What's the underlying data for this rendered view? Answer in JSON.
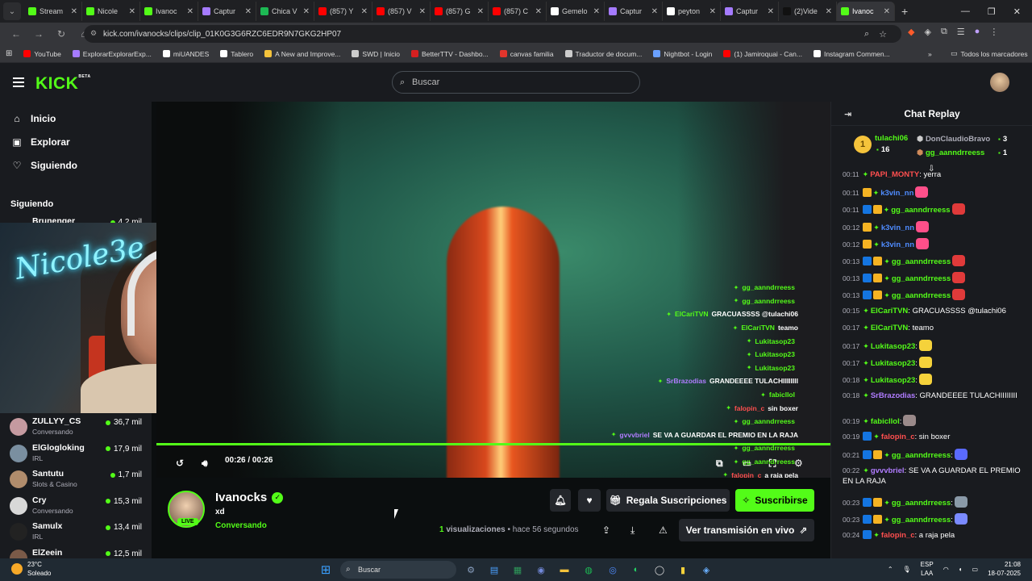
{
  "browser": {
    "tabs": [
      {
        "title": "Stream",
        "color": "#53fc18"
      },
      {
        "title": "Nicole",
        "color": "#53fc18"
      },
      {
        "title": "Ivanoc",
        "color": "#53fc18"
      },
      {
        "title": "Captur",
        "color": "#a57bff"
      },
      {
        "title": "Chica V",
        "color": "#1db954"
      },
      {
        "title": "(857) Y",
        "color": "#ff0000"
      },
      {
        "title": "(857) V",
        "color": "#ff0000"
      },
      {
        "title": "(857) G",
        "color": "#ff0000"
      },
      {
        "title": "(857) C",
        "color": "#ff0000"
      },
      {
        "title": "Gemelo",
        "color": "#ffffff"
      },
      {
        "title": "Captur",
        "color": "#a57bff"
      },
      {
        "title": "peyton",
        "color": "#ffffff"
      },
      {
        "title": "Captur",
        "color": "#a57bff"
      },
      {
        "title": "(2)Vide",
        "color": "#111111"
      },
      {
        "title": "Ivanoc",
        "color": "#53fc18"
      }
    ],
    "active_tab_index": 14,
    "url": "kick.com/ivanocks/clips/clip_01K0G3G6RZC6EDR9N7GKG2HP07",
    "bookmarks": [
      {
        "label": "YouTube",
        "color": "#ff0000"
      },
      {
        "label": "ExplorarExplorarExp...",
        "color": "#a57bff"
      },
      {
        "label": "miUANDES",
        "color": "#ffffff"
      },
      {
        "label": "Tablero",
        "color": "#ffffff"
      },
      {
        "label": "A New and Improve...",
        "color": "#f5c33b"
      },
      {
        "label": "SWD | Inicio",
        "color": "#cccccc"
      },
      {
        "label": "BetterTTV - Dashbo...",
        "color": "#d62020"
      },
      {
        "label": "canvas familia",
        "color": "#e2352c"
      },
      {
        "label": "Traductor de docum...",
        "color": "#cccccc"
      },
      {
        "label": "Nightbot - Login",
        "color": "#6aa0ff"
      },
      {
        "label": "(1) Jamiroquai - Can...",
        "color": "#ff0000"
      },
      {
        "label": "Instagram Commen...",
        "color": "#ffffff"
      }
    ],
    "all_bookmarks": "Todos los marcadores"
  },
  "kick": {
    "logo": "KICK",
    "logo_sup": "BETA",
    "search_placeholder": "Buscar"
  },
  "sidebar": {
    "nav": [
      {
        "label": "Inicio",
        "icon": "home-icon",
        "glyph": "⌂"
      },
      {
        "label": "Explorar",
        "icon": "compass-icon",
        "glyph": "▣"
      },
      {
        "label": "Siguiendo",
        "icon": "heart-icon",
        "glyph": "♡"
      }
    ],
    "following_title": "Siguiendo",
    "partial_first": {
      "name": "Brunenger",
      "viewers": "4,2 mil"
    },
    "follows": [
      {
        "name": "ZULLYY_CS",
        "category": "Conversando",
        "viewers": "36,7 mil",
        "color": "#c59aa0"
      },
      {
        "name": "ElGlogloking",
        "category": "IRL",
        "viewers": "17,9 mil",
        "color": "#7a8fa0"
      },
      {
        "name": "Santutu",
        "category": "Slots & Casino",
        "viewers": "1,7 mil",
        "color": "#b08c6c"
      },
      {
        "name": "Cry",
        "category": "Conversando",
        "viewers": "15,3 mil",
        "color": "#d8d8d8"
      },
      {
        "name": "Samulx",
        "category": "IRL",
        "viewers": "13,4 mil",
        "color": "#222222"
      },
      {
        "name": "ElZeein",
        "category": "",
        "viewers": "12,5 mil",
        "color": "#7a5a48"
      }
    ]
  },
  "webcam": {
    "neon_text": "Nicole3e"
  },
  "video": {
    "overlay_chat": [
      {
        "name": "gg_aanndrreess",
        "msg": "",
        "color": "n"
      },
      {
        "name": "gg_aanndrreess",
        "msg": "",
        "color": "n"
      },
      {
        "name": "ElCariTVN",
        "msg": "GRACUASSSS @tulachi06",
        "color": "n"
      },
      {
        "name": "ElCariTVN",
        "msg": "teamo",
        "color": "n"
      },
      {
        "name": "Lukitasop23",
        "msg": "",
        "color": "n"
      },
      {
        "name": "Lukitasop23",
        "msg": "",
        "color": "n"
      },
      {
        "name": "Lukitasop23",
        "msg": "",
        "color": "n"
      },
      {
        "name": "SrBrazodias",
        "msg": "GRANDEEEE TULACHIIIIIIII",
        "color": "p"
      },
      {
        "name": "fabicllol",
        "msg": "",
        "color": "n"
      },
      {
        "name": "falopin_c",
        "msg": "sin boxer",
        "color": "r"
      },
      {
        "name": "gg_aanndrreess",
        "msg": "",
        "color": "n"
      },
      {
        "name": "gvvvbriel",
        "msg": "SE VA A GUARDAR EL PREMIO EN LA RAJA",
        "color": "p"
      },
      {
        "name": "gg_aanndrreess",
        "msg": "",
        "color": "n"
      },
      {
        "name": "gg_aanndrreess",
        "msg": "",
        "color": "n"
      },
      {
        "name": "falopin_c",
        "msg": "a raja pela",
        "color": "r"
      }
    ],
    "current_time": "00:26",
    "separator": "/",
    "duration": "00:26",
    "progress_fraction": 1.0
  },
  "channel": {
    "name": "Ivanocks",
    "title": "xd",
    "category": "Conversando",
    "live_label": "LIVE",
    "gift_button": "Regala Suscripciones",
    "subscribe_button": "Suscribirse",
    "views_count": "1",
    "views_label": "visualizaciones",
    "dot": "•",
    "time_ago": "hace 56 segundos",
    "watch_live_button": "Ver transmisión en vivo"
  },
  "chat": {
    "title": "Chat Replay",
    "top_gifter": {
      "rank": "1",
      "name": "tulachi06",
      "count": "16"
    },
    "gifter_2": {
      "name": "DonClaudioBravo",
      "count": "3"
    },
    "gifter_3": {
      "name": "gg_aanndrreess",
      "count": "1"
    },
    "partial_top": {
      "time": "00:11",
      "name": "PAPI_MONTY",
      "text": ": yerra"
    },
    "messages": [
      {
        "time": "00:11",
        "badges": [
          "vip"
        ],
        "name": "k3vin_nn",
        "color": "#4f8cff",
        "text": "",
        "emote": "#ff4f8a"
      },
      {
        "time": "00:11",
        "badges": [
          "mod",
          "vip"
        ],
        "name": "gg_aanndrreess",
        "color": "#53fc18",
        "text": "",
        "emote": "#e03a3a"
      },
      {
        "time": "00:12",
        "badges": [
          "vip"
        ],
        "name": "k3vin_nn",
        "color": "#4f8cff",
        "text": "",
        "emote": "#ff4f8a"
      },
      {
        "time": "00:12",
        "badges": [
          "vip"
        ],
        "name": "k3vin_nn",
        "color": "#4f8cff",
        "text": "",
        "emote": "#ff4f8a"
      },
      {
        "time": "00:13",
        "badges": [
          "mod",
          "vip"
        ],
        "name": "gg_aanndrreess",
        "color": "#53fc18",
        "text": "",
        "emote": "#e03a3a"
      },
      {
        "time": "00:13",
        "badges": [
          "mod",
          "vip"
        ],
        "name": "gg_aanndrreess",
        "color": "#53fc18",
        "text": "",
        "emote": "#e03a3a"
      },
      {
        "time": "00:13",
        "badges": [
          "mod",
          "vip"
        ],
        "name": "gg_aanndrreess",
        "color": "#53fc18",
        "text": "",
        "emote": "#e03a3a"
      },
      {
        "time": "00:15",
        "badges": [],
        "name": "ElCariTVN",
        "color": "#53fc18",
        "text": ": GRACUASSSS @tulachi06",
        "emote": ""
      },
      {
        "time": "00:17",
        "badges": [],
        "name": "ElCariTVN",
        "color": "#53fc18",
        "text": ": teamo",
        "emote": ""
      },
      {
        "time": "00:17",
        "badges": [],
        "name": "Lukitasop23",
        "color": "#53fc18",
        "text": ":",
        "emote": "#f5d23b"
      },
      {
        "time": "00:17",
        "badges": [],
        "name": "Lukitasop23",
        "color": "#53fc18",
        "text": ":",
        "emote": "#f5d23b"
      },
      {
        "time": "00:18",
        "badges": [],
        "name": "Lukitasop23",
        "color": "#53fc18",
        "text": ":",
        "emote": "#f5d23b"
      },
      {
        "time": "00:18",
        "badges": [],
        "name": "SrBrazodias",
        "color": "#b07cff",
        "text": ": GRANDEEEE TULACHIIIIIIII",
        "emote": ""
      },
      {
        "time": "00:19",
        "badges": [],
        "name": "fabicllol",
        "color": "#53fc18",
        "text": ":",
        "emote": "#9a8a8a"
      },
      {
        "time": "00:19",
        "badges": [
          "mod"
        ],
        "name": "falopin_c",
        "color": "#ff4f4f",
        "text": ": sin boxer",
        "emote": ""
      },
      {
        "time": "00:21",
        "badges": [
          "mod",
          "vip"
        ],
        "name": "gg_aanndrreess",
        "color": "#53fc18",
        "text": ":",
        "emote": "#5a6aff"
      },
      {
        "time": "00:22",
        "badges": [],
        "name": "gvvvbriel",
        "color": "#b07cff",
        "text": ": SE VA A GUARDAR EL PREMIO EN LA RAJA",
        "emote": ""
      },
      {
        "time": "00:23",
        "badges": [
          "mod",
          "vip"
        ],
        "name": "gg_aanndrreess",
        "color": "#53fc18",
        "text": ":",
        "emote": "#8a9aa8"
      },
      {
        "time": "00:23",
        "badges": [
          "mod",
          "vip"
        ],
        "name": "gg_aanndrreess",
        "color": "#53fc18",
        "text": ":",
        "emote": "#7a8aff"
      },
      {
        "time": "00:24",
        "badges": [
          "mod"
        ],
        "name": "falopin_c",
        "color": "#ff4f4f",
        "text": ": a raja pela",
        "emote": ""
      }
    ]
  },
  "taskbar": {
    "temp": "23°C",
    "weather": "Soleado",
    "search": "Buscar",
    "lang_top": "ESP",
    "lang_bottom": "LAA",
    "time": "21:08",
    "date": "18-07-2025"
  }
}
